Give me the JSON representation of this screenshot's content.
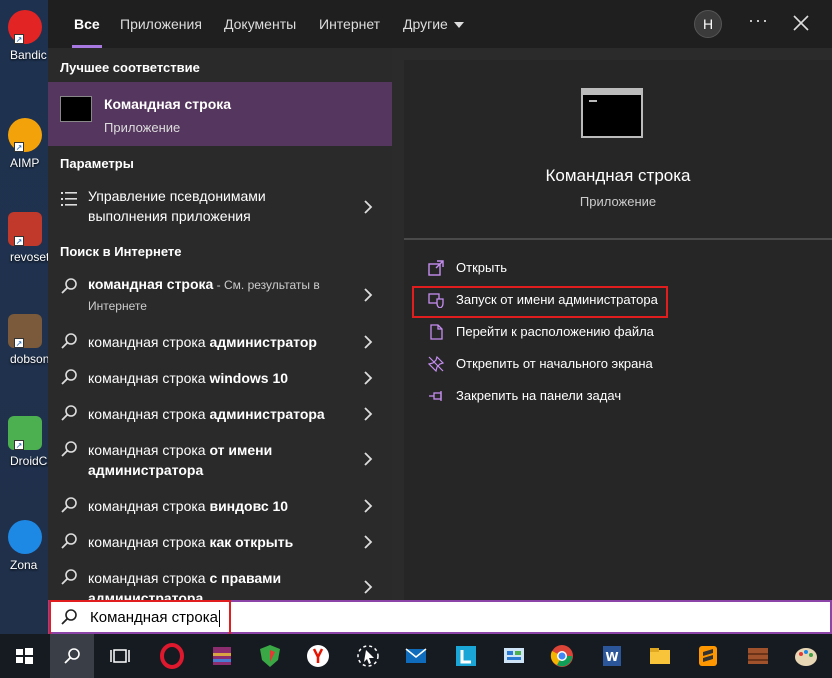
{
  "desktop": {
    "icons": [
      {
        "label": "Bandic",
        "icon": "bandicam-icon",
        "color": "#e32424"
      },
      {
        "label": "AIMP",
        "icon": "aimp-icon",
        "color": "#f4a20a"
      },
      {
        "label": "revosetu",
        "icon": "revo-uninstaller-icon",
        "color": "#c0392b"
      },
      {
        "label": "dobson",
        "icon": "dobson-app-icon",
        "color": "#7a5a3a"
      },
      {
        "label": "DroidCa",
        "icon": "droidcam-icon",
        "color": "#4caf50"
      },
      {
        "label": "Zona",
        "icon": "zona-icon",
        "color": "#1e88e5"
      }
    ]
  },
  "tabs": [
    {
      "label": "Все",
      "active": true
    },
    {
      "label": "Приложения",
      "active": false
    },
    {
      "label": "Документы",
      "active": false
    },
    {
      "label": "Интернет",
      "active": false
    },
    {
      "label": "Другие",
      "active": false
    }
  ],
  "header": {
    "avatar_letter": "H",
    "more": "···"
  },
  "left": {
    "best_match_heading": "Лучшее соответствие",
    "best_match": {
      "title": "Командная строка",
      "subtitle": "Приложение"
    },
    "settings_heading": "Параметры",
    "settings_item": {
      "line1": "Управление псевдонимами",
      "line2": "выполнения приложения"
    },
    "web_heading": "Поиск в Интернете",
    "web_results": [
      {
        "normal": "командная строка",
        "bold": "",
        "suffix": " - См. результаты в Интернете"
      },
      {
        "normal": "командная строка ",
        "bold": "администратор",
        "suffix": ""
      },
      {
        "normal": "командная строка ",
        "bold": "windows 10",
        "suffix": ""
      },
      {
        "normal": "командная строка ",
        "bold": "администратора",
        "suffix": ""
      },
      {
        "normal": "командная строка ",
        "bold": "от имени администратора",
        "suffix": ""
      },
      {
        "normal": "командная строка ",
        "bold": "виндовс 10",
        "suffix": ""
      },
      {
        "normal": "командная строка ",
        "bold": "как открыть",
        "suffix": ""
      },
      {
        "normal": "командная строка ",
        "bold": "с правами администратора",
        "suffix": ""
      }
    ]
  },
  "right": {
    "title": "Командная строка",
    "subtitle": "Приложение",
    "actions": [
      {
        "label": "Открыть",
        "icon": "open-icon"
      },
      {
        "label": "Запуск от имени администратора",
        "icon": "shield-icon"
      },
      {
        "label": "Перейти к расположению файла",
        "icon": "file-location-icon"
      },
      {
        "label": "Открепить от начального экрана",
        "icon": "unpin-icon"
      },
      {
        "label": "Закрепить на панели задач",
        "icon": "pin-icon"
      }
    ]
  },
  "search": {
    "value": "Командная строка"
  },
  "taskbar": {
    "items": [
      {
        "icon": "windows-start-icon"
      },
      {
        "icon": "search-icon",
        "active": true
      },
      {
        "icon": "task-view-icon"
      },
      {
        "icon": "opera-icon"
      },
      {
        "icon": "winrar-icon"
      },
      {
        "icon": "vpn-shield-icon"
      },
      {
        "icon": "yandex-browser-icon"
      },
      {
        "icon": "screenshot-tool-icon"
      },
      {
        "icon": "mail-icon"
      },
      {
        "icon": "l-app-icon"
      },
      {
        "icon": "control-panel-icon"
      },
      {
        "icon": "chrome-icon"
      },
      {
        "icon": "word-icon"
      },
      {
        "icon": "file-explorer-icon"
      },
      {
        "icon": "sublime-text-icon"
      },
      {
        "icon": "archive-icon"
      },
      {
        "icon": "paint-icon"
      }
    ]
  },
  "colors": {
    "accent": "#a678e0",
    "highlight": "#55365e",
    "annotation": "#e21d1d"
  }
}
